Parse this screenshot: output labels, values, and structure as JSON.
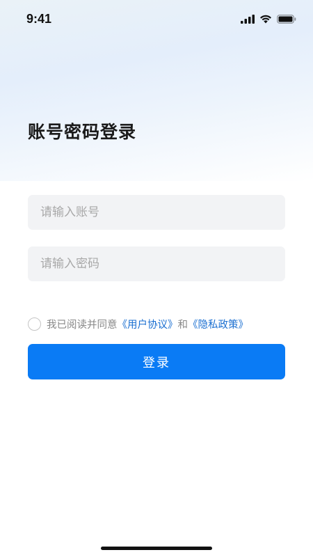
{
  "status_bar": {
    "time": "9:41"
  },
  "header": {
    "title": "账号密码登录"
  },
  "form": {
    "account_placeholder": "请输入账号",
    "account_value": "",
    "password_placeholder": "请输入密码",
    "password_value": ""
  },
  "agreement": {
    "checked": false,
    "prefix": "我已阅读并同意",
    "user_agreement": "《用户协议》",
    "and": "和",
    "privacy_policy": "《隐私政策》"
  },
  "login_button": {
    "label": "登录"
  },
  "colors": {
    "primary": "#0a7bf5",
    "link": "#1a6fd1",
    "input_bg": "#f2f3f5"
  },
  "icons": [
    "signal-icon",
    "wifi-icon",
    "battery-icon"
  ]
}
